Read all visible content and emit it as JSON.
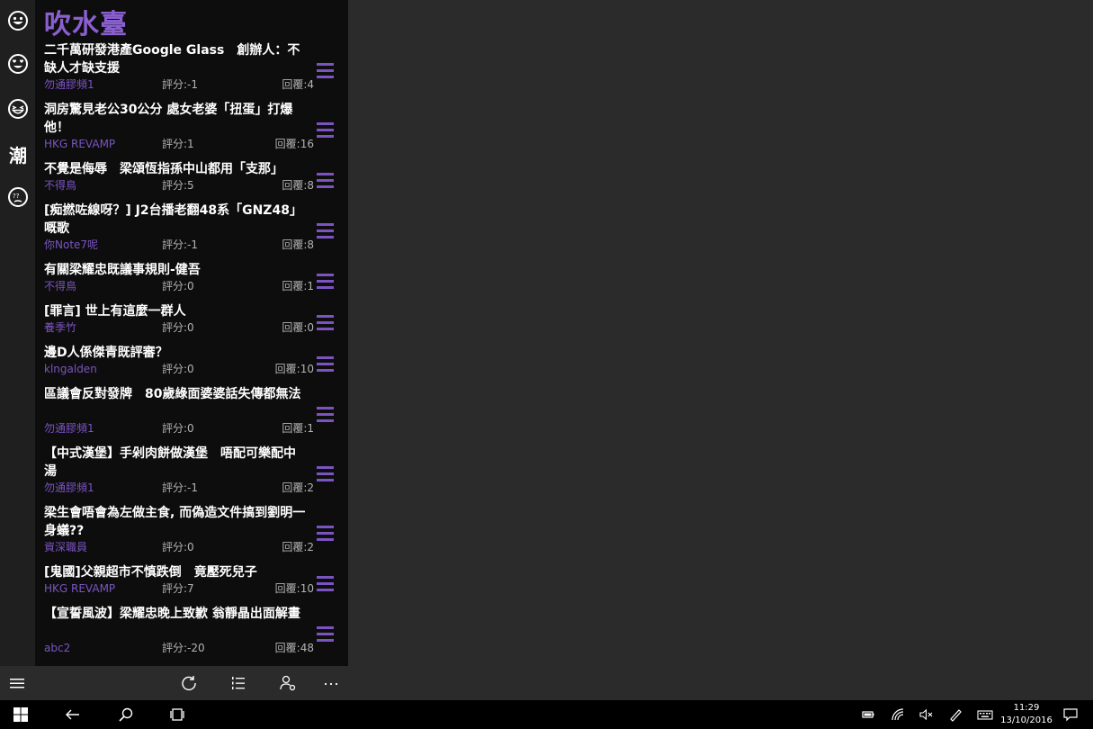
{
  "app": {
    "title": "吹水臺"
  },
  "rail": {
    "trend_label": "潮"
  },
  "topics": [
    {
      "title": "二千萬研發港產Google Glass　創辦人：不缺人才缺支援",
      "author": "勿通膠頻1",
      "score": "評分:-1",
      "replies": "回覆:4"
    },
    {
      "title": "洞房驚見老公30公分 處女老婆「扭蛋」打爆他！",
      "author": "HKG REVAMP",
      "score": "評分:1",
      "replies": "回覆:16"
    },
    {
      "title": "不覺是侮辱　梁頌恆指孫中山都用「支那」",
      "author": "不得鳥",
      "score": "評分:5",
      "replies": "回覆:8"
    },
    {
      "title": "[痴撚咗線呀？] J2台播老翻48系「GNZ48」嘅歌",
      "author": "你Note7呢",
      "score": "評分:-1",
      "replies": "回覆:8"
    },
    {
      "title": "有關梁耀忠既議事規則-健吾",
      "author": "不得鳥",
      "score": "評分:0",
      "replies": "回覆:1"
    },
    {
      "title": "[罪言] 世上有這麼一群人",
      "author": "養季竹",
      "score": "評分:0",
      "replies": "回覆:0"
    },
    {
      "title": "邊D人係傑青既評審？",
      "author": "klngalden",
      "score": "評分:0",
      "replies": "回覆:10"
    },
    {
      "title": "區議會反對發牌　80歲綠面婆婆話失傳都無法",
      "author": "勿通膠頻1",
      "score": "評分:0",
      "replies": "回覆:1"
    },
    {
      "title": "【中式漢堡】手剁肉餅做漢堡　唔配可樂配中湯",
      "author": "勿通膠頻1",
      "score": "評分:-1",
      "replies": "回覆:2"
    },
    {
      "title": "梁生會唔會為左做主食, 而偽造文件搞到劉明一身蟻??",
      "author": "資深職員",
      "score": "評分:0",
      "replies": "回覆:2"
    },
    {
      "title": "[鬼國]父親超市不慎跌倒　竟壓死兒子",
      "author": "HKG REVAMP",
      "score": "評分:7",
      "replies": "回覆:10"
    },
    {
      "title": "【宣誓風波】梁耀忠晚上致歉 翁靜晶出面解畫",
      "author": "abc2",
      "score": "評分:-20",
      "replies": "回覆:48"
    }
  ],
  "clock": {
    "time": "11:29",
    "date": "13/10/2016"
  },
  "colors": {
    "accent": "#7b54c2",
    "title": "#8a5fd0",
    "panel": "#0d0d0d",
    "desktop": "#2b2b2b"
  }
}
